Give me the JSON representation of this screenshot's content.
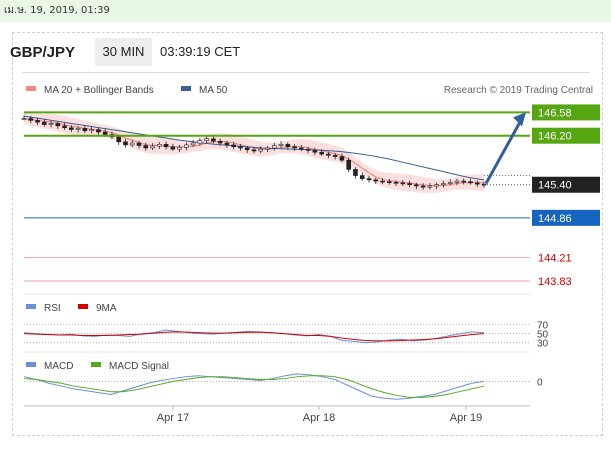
{
  "topbar": {
    "text": "เม.ษ. 19, 2019, 01:39"
  },
  "header": {
    "pair": "GBP/JPY",
    "timeframe": "30 MIN",
    "time": "03:39:19 CET"
  },
  "legend": {
    "ma20": "MA 20 + Bollinger Bands",
    "ma50": "MA 50",
    "credit": "Research © 2019 Trading Central",
    "ma20_color": "#f08a8a",
    "ma50_color": "#3a5f95"
  },
  "rsi_legend": {
    "rsi": "RSI",
    "ma9": "9MA",
    "rsi_color": "#6b8fd6",
    "ma9_color": "#d40000"
  },
  "macd_legend": {
    "macd": "MACD",
    "signal": "MACD Signal",
    "macd_color": "#6b8fd6",
    "signal_color": "#55aa22"
  },
  "chart_data": [
    {
      "type": "line",
      "title": "GBP/JPY",
      "x_ticks": [
        "Apr 17",
        "Apr 18",
        "Apr 19"
      ],
      "levels": [
        {
          "value": 146.58,
          "label": "146.58",
          "color": "#55a611",
          "kind": "resistance"
        },
        {
          "value": 146.2,
          "label": "146.20",
          "color": "#55a611",
          "kind": "resistance"
        },
        {
          "value": 145.4,
          "label": "145.40",
          "color": "#222222",
          "kind": "current"
        },
        {
          "value": 144.86,
          "label": "144.86",
          "color": "#1565c0",
          "kind": "pivot"
        },
        {
          "value": 144.21,
          "label": "144.21",
          "color": "#cc0000",
          "kind": "support"
        },
        {
          "value": 143.83,
          "label": "143.83",
          "color": "#cc0000",
          "kind": "support"
        }
      ],
      "series": [
        {
          "name": "Price",
          "values": [
            146.48,
            146.45,
            146.42,
            146.38,
            146.4,
            146.36,
            146.33,
            146.3,
            146.32,
            146.28,
            146.3,
            146.26,
            146.22,
            146.18,
            146.1,
            146.05,
            146.08,
            146.04,
            146.0,
            146.03,
            146.06,
            146.02,
            145.98,
            146.01,
            146.05,
            146.08,
            146.12,
            146.15,
            146.11,
            146.08,
            146.05,
            146.02,
            146.0,
            145.97,
            145.95,
            145.98,
            146.0,
            146.04,
            146.06,
            146.02,
            146.0,
            145.98,
            145.96,
            145.93,
            145.9,
            145.88,
            145.86,
            145.8,
            145.65,
            145.55,
            145.5,
            145.48,
            145.46,
            145.45,
            145.44,
            145.43,
            145.42,
            145.4,
            145.38,
            145.36,
            145.38,
            145.4,
            145.42,
            145.44,
            145.46,
            145.45,
            145.43,
            145.41,
            145.4
          ]
        },
        {
          "name": "MA 50",
          "values": [
            146.52,
            146.48,
            146.44,
            146.4,
            146.36,
            146.32,
            146.28,
            146.24,
            146.2,
            146.16,
            146.12,
            146.09,
            146.06,
            146.04,
            146.02,
            146.0,
            145.99,
            145.98,
            145.97,
            145.96,
            145.94,
            145.91,
            145.87,
            145.82,
            145.76,
            145.7,
            145.64,
            145.58,
            145.52,
            145.48
          ]
        }
      ]
    },
    {
      "type": "line",
      "title": "RSI",
      "y_ticks": [
        70,
        50,
        30
      ],
      "series": [
        {
          "name": "RSI",
          "values": [
            52,
            50,
            48,
            47,
            49,
            45,
            44,
            47,
            46,
            44,
            50,
            52,
            58,
            55,
            52,
            50,
            49,
            51,
            53,
            55,
            54,
            52,
            50,
            47,
            45,
            48,
            44,
            35,
            33,
            30,
            32,
            36,
            38,
            34,
            36,
            40,
            45,
            50,
            54,
            52
          ]
        },
        {
          "name": "9MA",
          "values": [
            50,
            49,
            48,
            47,
            47,
            46,
            46,
            46,
            47,
            48,
            49,
            51,
            53,
            54,
            53,
            52,
            51,
            51,
            52,
            53,
            53,
            52,
            50,
            48,
            46,
            46,
            44,
            40,
            37,
            35,
            34,
            34,
            35,
            36,
            37,
            39,
            42,
            45,
            48,
            50
          ]
        }
      ]
    },
    {
      "type": "line",
      "title": "MACD",
      "y_ticks": [
        0
      ],
      "series": [
        {
          "name": "MACD",
          "values": [
            0.05,
            0.02,
            -0.02,
            -0.05,
            -0.08,
            -0.1,
            -0.12,
            -0.14,
            -0.1,
            -0.06,
            -0.02,
            0.01,
            0.03,
            0.05,
            0.06,
            0.05,
            0.04,
            0.03,
            0.02,
            0.01,
            0.03,
            0.06,
            0.08,
            0.07,
            0.05,
            0.02,
            -0.04,
            -0.1,
            -0.16,
            -0.18,
            -0.19,
            -0.18,
            -0.16,
            -0.14,
            -0.1,
            -0.06,
            -0.02,
            0.0
          ]
        },
        {
          "name": "MACD Signal",
          "values": [
            0.03,
            0.02,
            0.0,
            -0.02,
            -0.05,
            -0.07,
            -0.09,
            -0.11,
            -0.11,
            -0.09,
            -0.06,
            -0.03,
            0.0,
            0.02,
            0.04,
            0.05,
            0.05,
            0.04,
            0.03,
            0.02,
            0.02,
            0.03,
            0.05,
            0.06,
            0.06,
            0.05,
            0.02,
            -0.03,
            -0.08,
            -0.12,
            -0.15,
            -0.17,
            -0.17,
            -0.16,
            -0.14,
            -0.11,
            -0.08,
            -0.05
          ]
        }
      ]
    }
  ]
}
